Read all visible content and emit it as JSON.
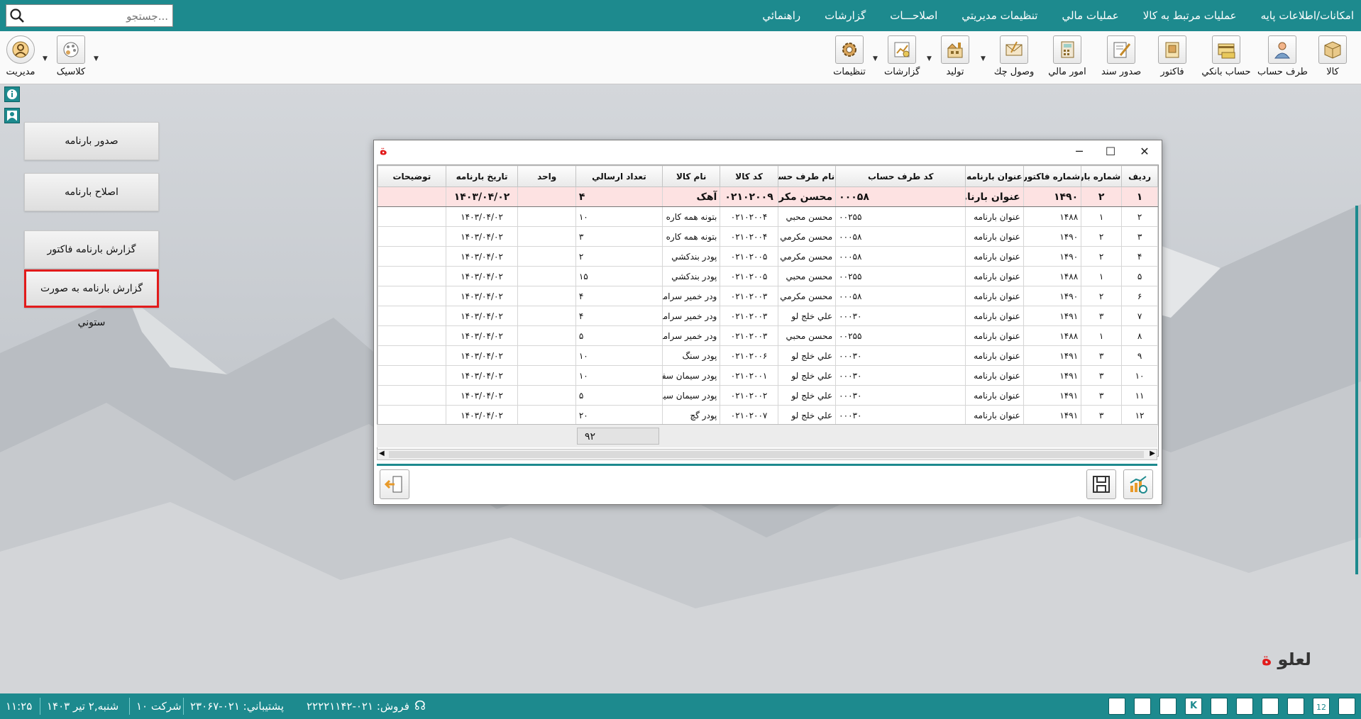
{
  "menu": {
    "items": [
      "امکانات/اطلاعات پایه",
      "عملیات مرتبط به کالا",
      "عملیات مالي",
      "تنظیمات مدیریتي",
      "اصلاحـــات",
      "گزارشات",
      "راهنمائي"
    ]
  },
  "search": {
    "placeholder": "جستجو..."
  },
  "toolbar": {
    "items": [
      "کالا",
      "طرف حساب",
      "حساب بانکي",
      "فاکتور",
      "صدور سند",
      "امور مالي",
      "وصول چك",
      "تولید",
      "گزارشات",
      "تنظیمات"
    ],
    "left_items": [
      "کلاسیک",
      "مدیریت"
    ]
  },
  "sidebar": {
    "buttons": [
      "صدور بارنامه",
      "اصلاح بارنامه",
      "گزارش بارنامه فاکتور",
      "گزارش بارنامه به صورت ستوني"
    ]
  },
  "dialog": {
    "columns": [
      "ردیف",
      "شماره بارنامه",
      "شماره فاکتور",
      "عنوان بارنامه",
      "کد طرف حساب",
      "نام طرف حساب",
      "کد کالا",
      "نام کالا",
      "تعداد ارسالي",
      "واحد",
      "تاریخ بارنامه",
      "توضیحات"
    ],
    "rows": [
      [
        "۱",
        "۲",
        "۱۴۹۰",
        "عنوان بارنامه",
        "۰۰۰۵۸",
        "محسن مکرمي",
        "۰۲۱۰۲۰۰۹",
        "آهک",
        "۴",
        "",
        "۱۴۰۳/۰۴/۰۲",
        ""
      ],
      [
        "۲",
        "۱",
        "۱۴۸۸",
        "عنوان بارنامه",
        "۰۰۲۵۵",
        "محسن محبي",
        "۰۲۱۰۲۰۰۴",
        "بتونه همه کاره",
        "۱۰",
        "",
        "۱۴۰۳/۰۴/۰۲",
        ""
      ],
      [
        "۳",
        "۲",
        "۱۴۹۰",
        "عنوان بارنامه",
        "۰۰۰۵۸",
        "محسن مکرمي",
        "۰۲۱۰۲۰۰۴",
        "بتونه همه کاره",
        "۳",
        "",
        "۱۴۰۳/۰۴/۰۲",
        ""
      ],
      [
        "۴",
        "۲",
        "۱۴۹۰",
        "عنوان بارنامه",
        "۰۰۰۵۸",
        "محسن مکرمي",
        "۰۲۱۰۲۰۰۵",
        "پودر بندکشي",
        "۲",
        "",
        "۱۴۰۳/۰۴/۰۲",
        ""
      ],
      [
        "۵",
        "۱",
        "۱۴۸۸",
        "عنوان بارنامه",
        "۰۰۲۵۵",
        "محسن محبي",
        "۰۲۱۰۲۰۰۵",
        "پودر بندکشي",
        "۱۵",
        "",
        "۱۴۰۳/۰۴/۰۲",
        ""
      ],
      [
        "۶",
        "۲",
        "۱۴۹۰",
        "عنوان بارنامه",
        "۰۰۰۵۸",
        "محسن مکرمي",
        "۰۲۱۰۲۰۰۳",
        "ودر خمیر سرامیک",
        "۴",
        "",
        "۱۴۰۳/۰۴/۰۲",
        ""
      ],
      [
        "۷",
        "۳",
        "۱۴۹۱",
        "عنوان بارنامه",
        "۰۰۰۳۰",
        "علي خلج لو",
        "۰۲۱۰۲۰۰۳",
        "ودر خمیر سرامیک",
        "۴",
        "",
        "۱۴۰۳/۰۴/۰۲",
        ""
      ],
      [
        "۸",
        "۱",
        "۱۴۸۸",
        "عنوان بارنامه",
        "۰۰۲۵۵",
        "محسن محبي",
        "۰۲۱۰۲۰۰۳",
        "ودر خمیر سرامیک",
        "۵",
        "",
        "۱۴۰۳/۰۴/۰۲",
        ""
      ],
      [
        "۹",
        "۳",
        "۱۴۹۱",
        "عنوان بارنامه",
        "۰۰۰۳۰",
        "علي خلج لو",
        "۰۲۱۰۲۰۰۶",
        "پودر سنگ",
        "۱۰",
        "",
        "۱۴۰۳/۰۴/۰۲",
        ""
      ],
      [
        "۱۰",
        "۳",
        "۱۴۹۱",
        "عنوان بارنامه",
        "۰۰۰۳۰",
        "علي خلج لو",
        "۰۲۱۰۲۰۰۱",
        "پودر سیمان سفید",
        "۱۰",
        "",
        "۱۴۰۳/۰۴/۰۲",
        ""
      ],
      [
        "۱۱",
        "۳",
        "۱۴۹۱",
        "عنوان بارنامه",
        "۰۰۰۳۰",
        "علي خلج لو",
        "۰۲۱۰۲۰۰۲",
        "پودر سیمان سیاه",
        "۵",
        "",
        "۱۴۰۳/۰۴/۰۲",
        ""
      ],
      [
        "۱۲",
        "۳",
        "۱۴۹۱",
        "عنوان بارنامه",
        "۰۰۰۳۰",
        "علي خلج لو",
        "۰۲۱۰۲۰۰۷",
        "پودر گچ",
        "۲۰",
        "",
        "۱۴۰۳/۰۴/۰۲",
        ""
      ]
    ],
    "total": "۹۲"
  },
  "logo": {
    "text": "لعلو",
    "mark": "ة"
  },
  "status": {
    "sales": "فروش:  ۰۲۱-۲۲۲۲۱۱۴۲",
    "support": "پشتیباني:  ۰۲۱-۲۳۰۶۷",
    "company": "شرکت ۱۰",
    "date": "شنبه,۲ تیر ۱۴۰۳",
    "time": "۱۱:۲۵",
    "calendar_day": "12"
  },
  "colors": {
    "accent": "#1d8a8e",
    "highlight": "#e21b1b",
    "selected_row": "#fde2e2"
  }
}
